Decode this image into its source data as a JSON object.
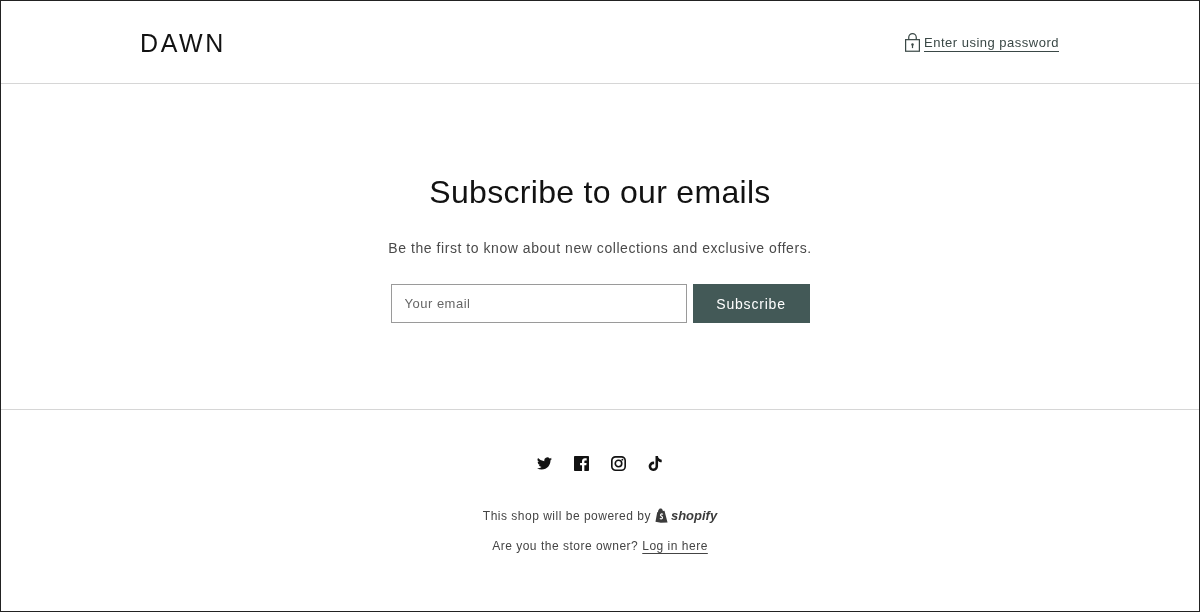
{
  "header": {
    "logo": "DAWN",
    "password_link": "Enter using password"
  },
  "newsletter": {
    "heading": "Subscribe to our emails",
    "text": "Be the first to know about new collections and exclusive offers.",
    "email_field": {
      "placeholder": "Your email"
    },
    "button": "Subscribe"
  },
  "footer": {
    "powered_by": "This shop will be powered by",
    "brand": "shopify",
    "owner_prompt": "Are you the store owner?",
    "login_link": "Log in here"
  }
}
